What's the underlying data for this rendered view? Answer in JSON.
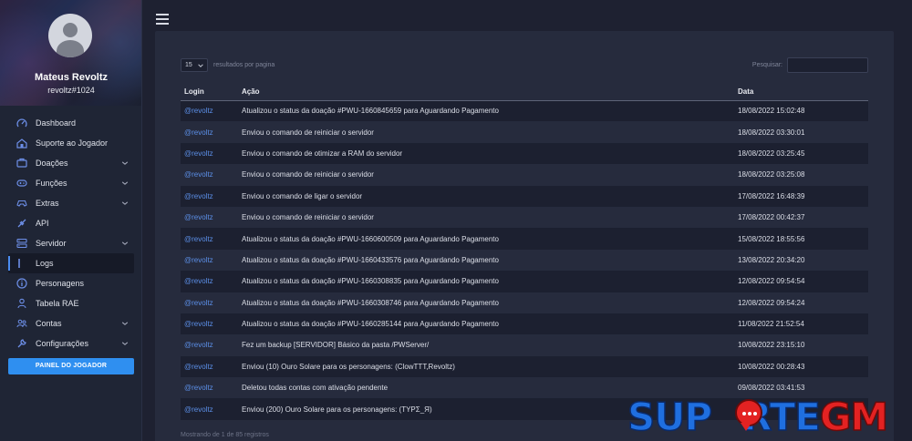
{
  "profile": {
    "name": "Mateus Revoltz",
    "tag": "revoltz#1024"
  },
  "sidebar": {
    "items": [
      {
        "label": "Dashboard",
        "icon": "dashboard-icon",
        "expandable": false,
        "active": false
      },
      {
        "label": "Suporte ao Jogador",
        "icon": "support-icon",
        "expandable": false,
        "active": false
      },
      {
        "label": "Doações",
        "icon": "donation-icon",
        "expandable": true,
        "active": false
      },
      {
        "label": "Funções",
        "icon": "gamepad-icon",
        "expandable": true,
        "active": false
      },
      {
        "label": "Extras",
        "icon": "controller-icon",
        "expandable": true,
        "active": false
      },
      {
        "label": "API",
        "icon": "plug-icon",
        "expandable": false,
        "active": false
      },
      {
        "label": "Servidor",
        "icon": "server-icon",
        "expandable": true,
        "active": false
      },
      {
        "label": "Logs",
        "icon": "logs-icon",
        "expandable": false,
        "active": true
      },
      {
        "label": "Personagens",
        "icon": "info-icon",
        "expandable": false,
        "active": false
      },
      {
        "label": "Tabela RAE",
        "icon": "table-icon",
        "expandable": false,
        "active": false
      },
      {
        "label": "Contas",
        "icon": "users-icon",
        "expandable": true,
        "active": false
      },
      {
        "label": "Configurações",
        "icon": "wrench-icon",
        "expandable": true,
        "active": false
      }
    ],
    "panel_button": "PAINEL DO JOGADOR"
  },
  "controls": {
    "per_page_value": "15",
    "per_page_label": "resultados por pagina",
    "search_label": "Pesquisar:",
    "search_value": ""
  },
  "table": {
    "headers": [
      "Login",
      "Ação",
      "Data"
    ],
    "rows": [
      {
        "login": "@revoltz",
        "action": "Atualizou o status da doação #PWU-1660845659 para Aguardando Pagamento",
        "date": "18/08/2022 15:02:48"
      },
      {
        "login": "@revoltz",
        "action": "Enviou o comando de reiniciar o servidor",
        "date": "18/08/2022 03:30:01"
      },
      {
        "login": "@revoltz",
        "action": "Enviou o comando de otimizar a RAM do servidor",
        "date": "18/08/2022 03:25:45"
      },
      {
        "login": "@revoltz",
        "action": "Enviou o comando de reiniciar o servidor",
        "date": "18/08/2022 03:25:08"
      },
      {
        "login": "@revoltz",
        "action": "Enviou o comando de ligar o servidor",
        "date": "17/08/2022 16:48:39"
      },
      {
        "login": "@revoltz",
        "action": "Enviou o comando de reiniciar o servidor",
        "date": "17/08/2022 00:42:37"
      },
      {
        "login": "@revoltz",
        "action": "Atualizou o status da doação #PWU-1660600509 para Aguardando Pagamento",
        "date": "15/08/2022 18:55:56"
      },
      {
        "login": "@revoltz",
        "action": "Atualizou o status da doação #PWU-1660433576 para Aguardando Pagamento",
        "date": "13/08/2022 20:34:20"
      },
      {
        "login": "@revoltz",
        "action": "Atualizou o status da doação #PWU-1660308835 para Aguardando Pagamento",
        "date": "12/08/2022 09:54:54"
      },
      {
        "login": "@revoltz",
        "action": "Atualizou o status da doação #PWU-1660308746 para Aguardando Pagamento",
        "date": "12/08/2022 09:54:24"
      },
      {
        "login": "@revoltz",
        "action": "Atualizou o status da doação #PWU-1660285144 para Aguardando Pagamento",
        "date": "11/08/2022 21:52:54"
      },
      {
        "login": "@revoltz",
        "action": "Fez um backup [SERVIDOR] Básico da pasta /PWServer/",
        "date": "10/08/2022 23:15:10"
      },
      {
        "login": "@revoltz",
        "action": "Enviou (10) Ouro Solare para os personagens: (ClowTTT,Revoltz)",
        "date": "10/08/2022 00:28:43"
      },
      {
        "login": "@revoltz",
        "action": "Deletou todas contas com ativação pendente",
        "date": "09/08/2022 03:41:53"
      },
      {
        "login": "@revoltz",
        "action": "Enviou (200) Ouro Solare para os personagens: (TYPΣ_Я)",
        "date": ""
      }
    ]
  },
  "footer": {
    "info": "Mostrando de 1 de 85 registros"
  },
  "watermark": {
    "part1": "SUP",
    "part2": "RTE",
    "part3": "GM"
  }
}
